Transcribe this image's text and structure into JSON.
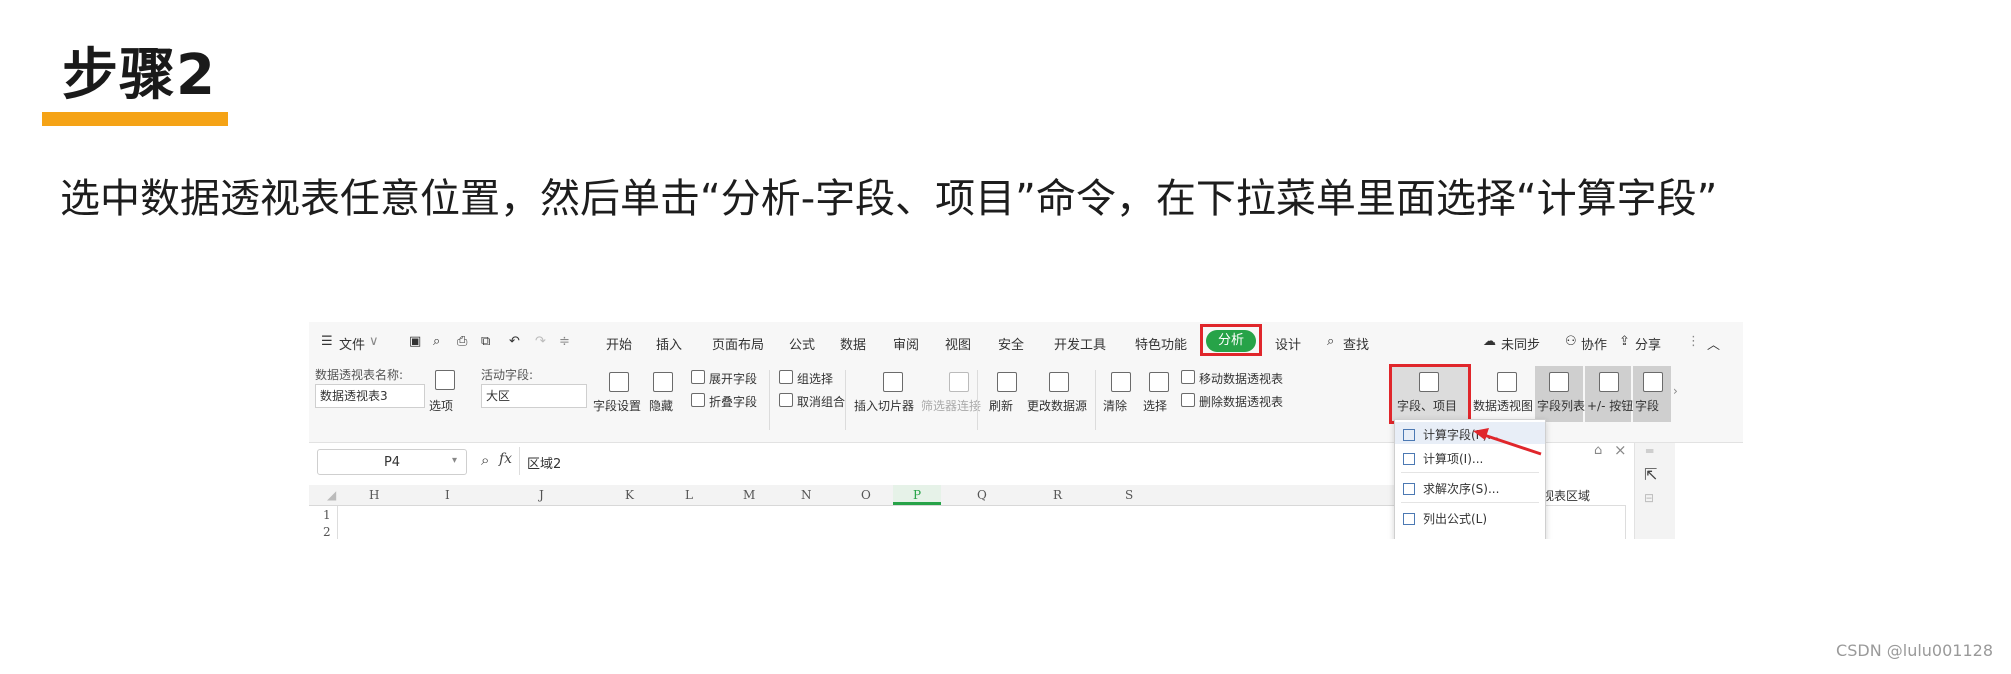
{
  "slide": {
    "title": "步骤2",
    "instruction": "选中数据透视表任意位置，然后单击“分析-字段、项目”命令，在下拉菜单里面选择“计算字段”",
    "accent_color": "#f5a316",
    "watermark": "CSDN @lulu001128"
  },
  "menubar": {
    "file_label": "文件",
    "tabs": [
      "开始",
      "插入",
      "页面布局",
      "公式",
      "数据",
      "审阅",
      "视图",
      "安全",
      "开发工具",
      "特色功能",
      "分析",
      "设计"
    ],
    "active_tab": "分析",
    "search_label": "查找",
    "sync_label": "未同步",
    "collab_label": "协作",
    "share_label": "分享"
  },
  "ribbon": {
    "pivot_name_label": "数据透视表名称:",
    "pivot_name_value": "数据透视表3",
    "options_label": "选项",
    "active_field_label": "活动字段:",
    "active_field_value": "大区",
    "field_settings": "字段设置",
    "hide": "隐藏",
    "expand_field": "展开字段",
    "collapse_field": "折叠字段",
    "group_select": "组选择",
    "ungroup": "取消组合",
    "insert_slicer": "插入切片器",
    "filter_connection": "筛选器连接",
    "refresh": "刷新",
    "change_source": "更改数据源",
    "clear": "清除",
    "select": "选择",
    "move_pivot": "移动数据透视表",
    "delete_pivot": "删除数据透视表",
    "fields_items": "字段、项目",
    "pivot_chart": "数据透视图",
    "field_list": "字段列表",
    "plus_minus_button": "+/- 按钮",
    "field_header": "字段"
  },
  "formula_bar": {
    "cell_ref": "P4",
    "fx": "fx",
    "formula": "区域2"
  },
  "grid": {
    "columns": [
      "H",
      "I",
      "J",
      "K",
      "L",
      "M",
      "N",
      "O",
      "P",
      "Q",
      "R",
      "S"
    ],
    "rows": [
      "1",
      "2"
    ]
  },
  "dropdown": {
    "items": [
      "计算字段(F)...",
      "计算项(I)...",
      "求解次序(S)...",
      "列出公式(L)"
    ]
  },
  "right_pane": {
    "area_label": "据透视表区域"
  },
  "colors": {
    "highlight_box": "#e0262b",
    "active_tab_bg": "#27a348",
    "selected_column": "#27a348"
  }
}
